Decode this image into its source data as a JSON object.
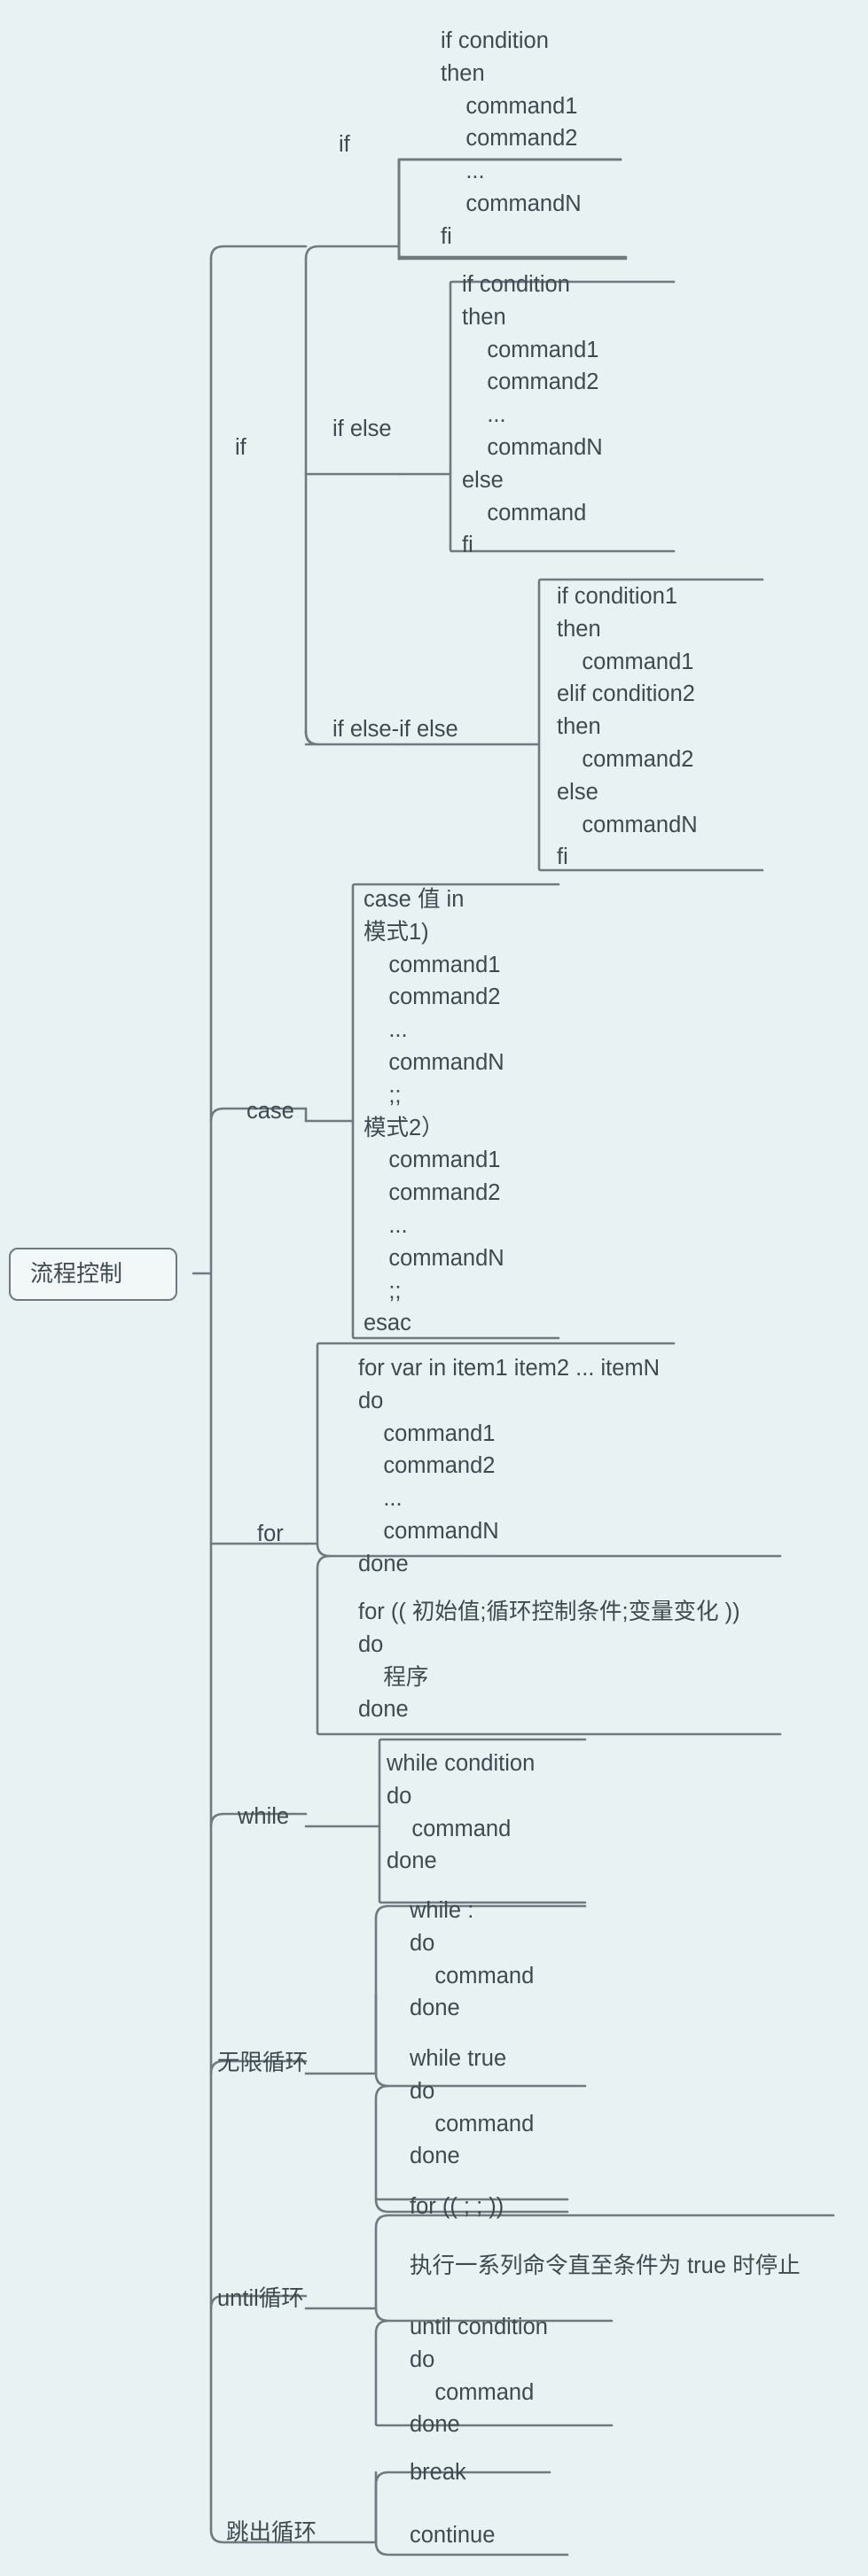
{
  "meta": {
    "background_color": "#e8f2f2",
    "line_color": "#6e7a80",
    "text_color": "#3d4a4f",
    "root_fill": "#f2f7f7"
  },
  "root": {
    "label": "流程控制"
  },
  "branches": {
    "if": {
      "label": "if"
    },
    "case": {
      "label": "case"
    },
    "for": {
      "label": "for"
    },
    "while": {
      "label": "while"
    },
    "infinite": {
      "label": "无限循环"
    },
    "until": {
      "label": "until循环"
    },
    "break_out": {
      "label": "跳出循环"
    }
  },
  "if_children": {
    "if": {
      "label": "if"
    },
    "if_else": {
      "label": "if else"
    },
    "if_elseif_else": {
      "label": "if else-if else"
    }
  },
  "leaves": {
    "if_simple": [
      "if condition",
      "then",
      "    command1",
      "    command2",
      "    ...",
      "    commandN",
      "fi"
    ],
    "if_else": [
      "if condition",
      "then",
      "    command1",
      "    command2",
      "    ...",
      "    commandN",
      "else",
      "    command",
      "fi"
    ],
    "if_elseif_else": [
      "if condition1",
      "then",
      "    command1",
      "elif condition2",
      "then",
      "    command2",
      "else",
      "    commandN",
      "fi"
    ],
    "case": [
      "case 值 in",
      "模式1)",
      "    command1",
      "    command2",
      "    ...",
      "    commandN",
      "    ;;",
      "模式2）",
      "    command1",
      "    command2",
      "    ...",
      "    commandN",
      "    ;;",
      "esac"
    ],
    "for_in": [
      "for var in item1 item2 ... itemN",
      "do",
      "    command1",
      "    command2",
      "    ...",
      "    commandN",
      "done"
    ],
    "for_cstyle": [
      "for (( 初始值;循环控制条件;变量变化 ))",
      "do",
      "    程序",
      "done"
    ],
    "while": [
      "while condition",
      "do",
      "    command",
      "done"
    ],
    "infinite_while_colon": [
      "while :",
      "do",
      "    command",
      "done"
    ],
    "infinite_while_true": [
      "while true",
      "do",
      "    command",
      "done"
    ],
    "infinite_for": [
      "for (( ; ; ))"
    ],
    "until_note": [
      "执行一系列命令直至条件为 true 时停止"
    ],
    "until_code": [
      "until condition",
      "do",
      "    command",
      "done"
    ],
    "break": [
      "break"
    ],
    "continue": [
      "continue"
    ]
  },
  "chart_data": {
    "type": "tree",
    "title": "流程控制",
    "nodes": [
      {
        "label": "if",
        "children": [
          {
            "label": "if",
            "text": "if condition\nthen\n    command1\n    command2\n    ...\n    commandN\nfi"
          },
          {
            "label": "if else",
            "text": "if condition\nthen\n    command1\n    command2\n    ...\n    commandN\nelse\n    command\nfi"
          },
          {
            "label": "if else-if else",
            "text": "if condition1\nthen\n    command1\nelif condition2\nthen\n    command2\nelse\n    commandN\nfi"
          }
        ]
      },
      {
        "label": "case",
        "children": [
          {
            "label": "",
            "text": "case 值 in\n模式1)\n    command1\n    command2\n    ...\n    commandN\n    ;;\n模式2）\n    command1\n    command2\n    ...\n    commandN\n    ;;\nesac"
          }
        ]
      },
      {
        "label": "for",
        "children": [
          {
            "label": "",
            "text": "for var in item1 item2 ... itemN\ndo\n    command1\n    command2\n    ...\n    commandN\ndone"
          },
          {
            "label": "",
            "text": "for (( 初始值;循环控制条件;变量变化 ))\ndo\n    程序\ndone"
          }
        ]
      },
      {
        "label": "while",
        "children": [
          {
            "label": "",
            "text": "while condition\ndo\n    command\ndone"
          }
        ]
      },
      {
        "label": "无限循环",
        "children": [
          {
            "label": "",
            "text": "while :\ndo\n    command\ndone"
          },
          {
            "label": "",
            "text": "while true\ndo\n    command\ndone"
          },
          {
            "label": "",
            "text": "for (( ; ; ))"
          }
        ]
      },
      {
        "label": "until循环",
        "children": [
          {
            "label": "",
            "text": "执行一系列命令直至条件为 true 时停止"
          },
          {
            "label": "",
            "text": "until condition\ndo\n    command\ndone"
          }
        ]
      },
      {
        "label": "跳出循环",
        "children": [
          {
            "label": "",
            "text": "break"
          },
          {
            "label": "",
            "text": "continue"
          }
        ]
      }
    ]
  }
}
